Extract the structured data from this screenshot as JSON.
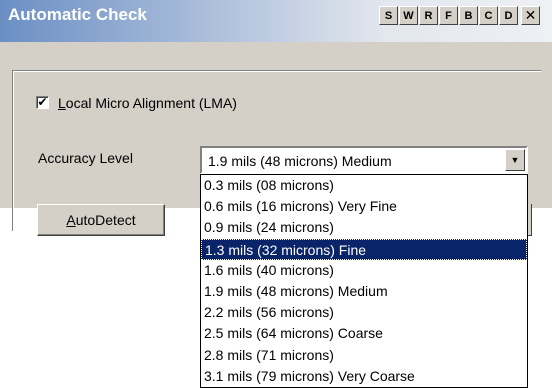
{
  "window": {
    "title": "Automatic Check",
    "title_buttons": [
      "S",
      "W",
      "R",
      "F",
      "B",
      "C",
      "D",
      "✕"
    ]
  },
  "lma": {
    "checked": true,
    "check_mark": "✔",
    "label_accel": "L",
    "label_rest": "ocal Micro Alignment (LMA)"
  },
  "accuracy": {
    "label": "Accuracy Level",
    "selected_value": "1.9 mils (48 microns) Medium",
    "arrow_glyph": "▼",
    "options": [
      "0.3 mils (08 microns)",
      "0.6 mils (16 microns) Very Fine",
      "0.9 mils (24 microns)",
      "1.3 mils (32 microns) Fine",
      "1.6 mils (40 microns)",
      "1.9 mils (48 microns) Medium",
      "2.2 mils (56 microns)",
      "2.5 mils (64 microns) Coarse",
      "2.8 mils (71 microns)",
      "3.1 mils (79 microns) Very Coarse"
    ],
    "highlighted_option": "1.3 mils (32 microns) Fine"
  },
  "autodetect": {
    "accel": "A",
    "rest": "utoDetect"
  },
  "colors": {
    "title_gradient_start": "#6b8fc4",
    "dialog_face": "#d4d0c8",
    "selection_highlight": "#0a246a"
  }
}
